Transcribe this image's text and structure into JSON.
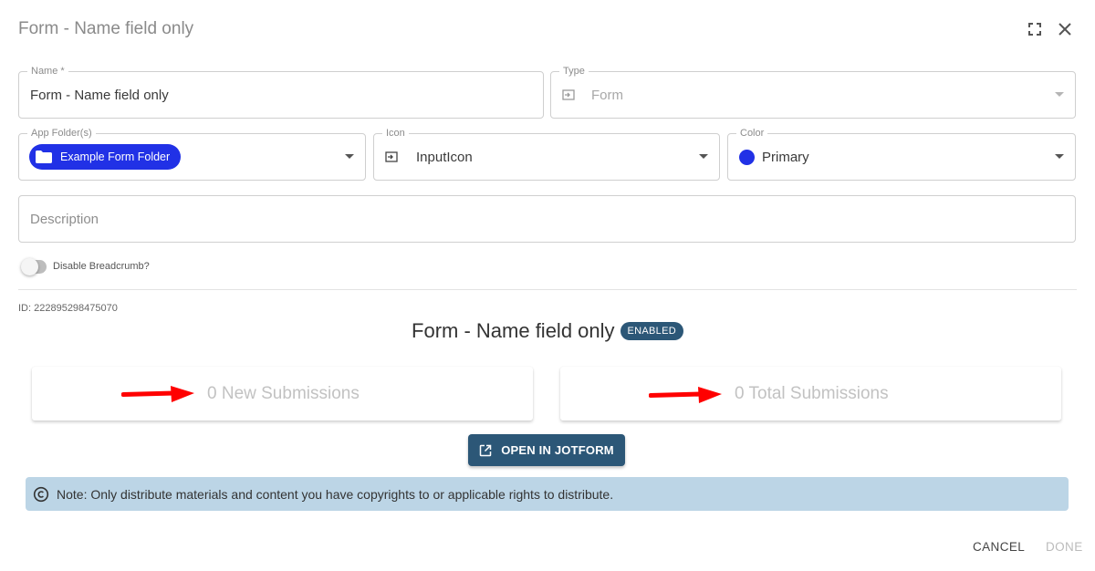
{
  "dialog": {
    "title": "Form - Name field only",
    "icons": {
      "fullscreen": "fullscreen-icon",
      "close": "close-icon"
    }
  },
  "fields": {
    "name": {
      "label": "Name *",
      "value": "Form - Name field only"
    },
    "type": {
      "label": "Type",
      "value": "Form",
      "icon": "input-icon"
    },
    "app_folders": {
      "label": "App Folder(s)",
      "chip": "Example Form Folder",
      "icon": "folder-icon"
    },
    "icon": {
      "label": "Icon",
      "value": "InputIcon",
      "icon": "input-icon"
    },
    "color": {
      "label": "Color",
      "value": "Primary",
      "swatch": "#2131e6"
    },
    "description": {
      "placeholder": "Description"
    }
  },
  "toggle": {
    "label": "Disable Breadcrumb?",
    "checked": false
  },
  "id_text": "ID: 222895298475070",
  "form_summary": {
    "name": "Form - Name field only",
    "status_badge": "ENABLED",
    "new_submissions": "0 New Submissions",
    "total_submissions": "0 Total Submissions",
    "open_button": "OPEN IN JOTFORM"
  },
  "note": {
    "text": "Note: Only distribute materials and content you have copyrights to or applicable rights to distribute.",
    "icon": "copyright-icon"
  },
  "footer": {
    "cancel": "CANCEL",
    "done": "DONE"
  },
  "colors": {
    "primary": "#2131e6",
    "accent_dark": "#2c5777",
    "note_bg": "#bcd5e6",
    "arrow": "#ff0000"
  }
}
